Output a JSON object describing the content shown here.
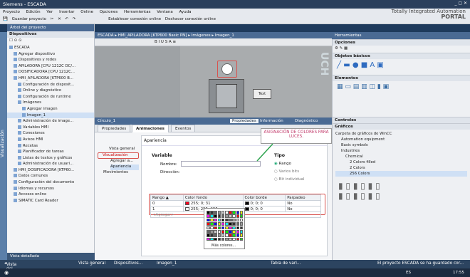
{
  "titlebar": {
    "title": "Siemens - ESCADA",
    "winbtns": "_ ▢ ✕"
  },
  "menu": [
    "Proyecto",
    "Edición",
    "Ver",
    "Insertar",
    "Online",
    "Opciones",
    "Herramientas",
    "Ventana",
    "Ayuda"
  ],
  "toolbar": {
    "save": "Guardar proyecto",
    "online": "Establecer conexión online",
    "offline": "Deshacer conexión online"
  },
  "tia": {
    "line1": "Totally Integrated Automation",
    "line2": "PORTAL"
  },
  "breadcrumb": "ESCADA ▸ HMI_APILADORA [KTP600 Basic PN] ▸ Imágenes ▸ Imagen_1",
  "left_header": "Árbol del proyecto",
  "dispositivos": "Dispositivos",
  "vertical_tab": "Visualización",
  "tree": [
    "ESCADA",
    "Agregar dispositivo",
    "Dispositivos y redes",
    "APILADORA [CPU 1212C DC/...",
    "DOSIFICADORA [CPU 1212C...",
    "HMI_APILADORA [KTP600 B...",
    "Configuración de disposit...",
    "Online y diagnóstico",
    "Configuración de runtime",
    "Imágenes",
    "Agregar imagen",
    "Imagen_1",
    "Administración de image...",
    "Variables HMI",
    "Conexiones",
    "Avisos HMI",
    "Recetas",
    "Planificador de tareas",
    "Listas de textos y gráficos",
    "Administración de usuari...",
    "HMI_DOSIFICADORA [KTP60...",
    "Datos comunes",
    "Configuración del documento",
    "Idiomas y recursos",
    "Accesos online",
    "SIMATIC Card Reader"
  ],
  "vista_detallada": "Vista detallada",
  "canvas": {
    "text_label": "Text",
    "vertical_text": "UCH"
  },
  "props_header": {
    "object": "Círculo_1",
    "propiedades": "Propiedades",
    "informacion": "Información",
    "diagnostico": "Diagnóstico"
  },
  "tabs": [
    "Propiedades",
    "Animaciones",
    "Eventos"
  ],
  "anim_nav": [
    "Vista general",
    "Visualización",
    "Agregar a...",
    "Apariencia",
    "Movimientos"
  ],
  "apariencia": "Apariencia",
  "variable": {
    "title": "Variable",
    "nombre": "Nombre:",
    "direccion": "Dirección:"
  },
  "tipo": {
    "title": "Tipo",
    "options": [
      "Rango",
      "Varios bits",
      "Bit individual"
    ]
  },
  "table": {
    "headers": [
      "Rango ▲",
      "Color fondo",
      "Color borde",
      "Parpadeo"
    ],
    "rows": [
      {
        "rango": "0",
        "fondo": "255; 0; 31",
        "borde": "0; 0; 0",
        "parpadeo": "No",
        "fondo_color": "#ff001f"
      },
      {
        "rango": "1",
        "fondo": "255; 255; 255",
        "borde": "0; 0; 0",
        "parpadeo": "No",
        "fondo_color": "#ffffff"
      }
    ],
    "add": "<Agregar>"
  },
  "palette_more": "Más colores...",
  "callout": "ASIGNACIÓN DE COLORES PARA LUCES.",
  "right": {
    "header": "Herramientas",
    "opciones": "Opciones",
    "objetos": "Objetos básicos",
    "elementos": "Elementos",
    "controles": "Controles",
    "graficos": "Gráficos",
    "tree": [
      "Carpeta de gráficos de WinCC",
      "Automation equipment",
      "Basic symbols",
      "Industries",
      "Chemical",
      "2 Colors filled",
      "2 Colors",
      "256 Colors"
    ]
  },
  "status": {
    "vista_portal": "Vista del portal",
    "items": [
      "Vista general",
      "Dispositivos...",
      "Imagen_1",
      "Tabla de vari..."
    ],
    "msg": "El proyecto ESCADA se ha guardado cor..."
  },
  "taskbar": {
    "clock": "17:55",
    "lang": "ES"
  },
  "colors": {
    "red": "#d9534f",
    "green": "#2ea44f"
  }
}
